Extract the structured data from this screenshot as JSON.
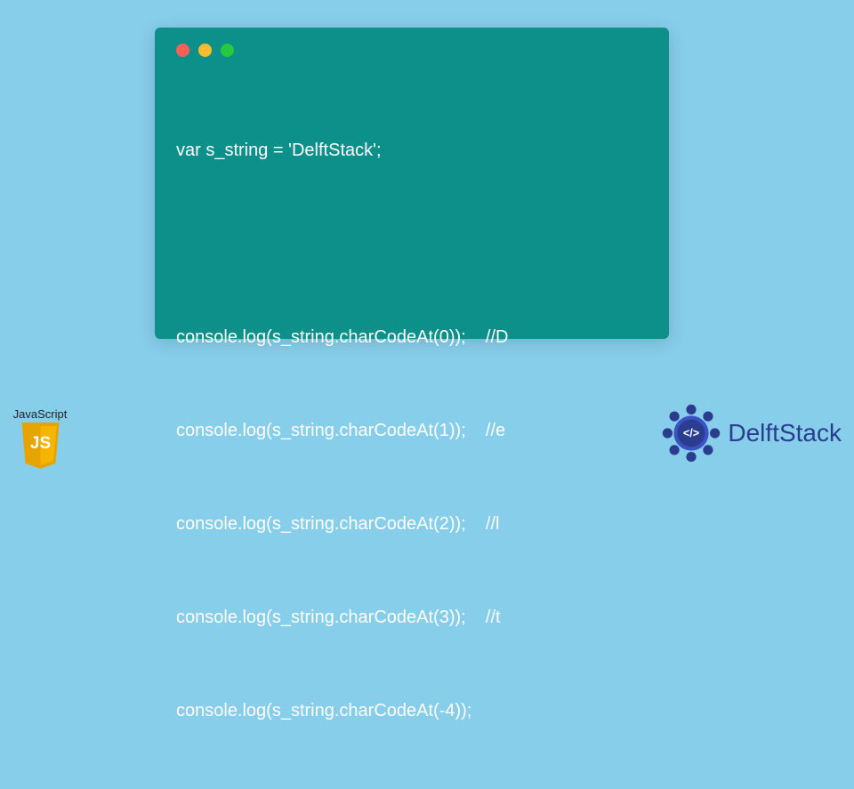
{
  "code": {
    "lines": [
      "var s_string = 'DelftStack';",
      "",
      "console.log(s_string.charCodeAt(0));    //D",
      "console.log(s_string.charCodeAt(1));    //e",
      "console.log(s_string.charCodeAt(2));    //l",
      "console.log(s_string.charCodeAt(3));    //t",
      "console.log(s_string.charCodeAt(-4));"
    ]
  },
  "js_badge": {
    "label": "JavaScript",
    "icon_text": "JS"
  },
  "delftstack": {
    "text": "DelftStack",
    "emblem_symbol": "</>"
  },
  "colors": {
    "bg": "#87ceeb",
    "window": "#0d8f8a",
    "code_text": "#ffffff",
    "js_yellow": "#f7b500",
    "delft_blue": "#2a3d8f"
  }
}
